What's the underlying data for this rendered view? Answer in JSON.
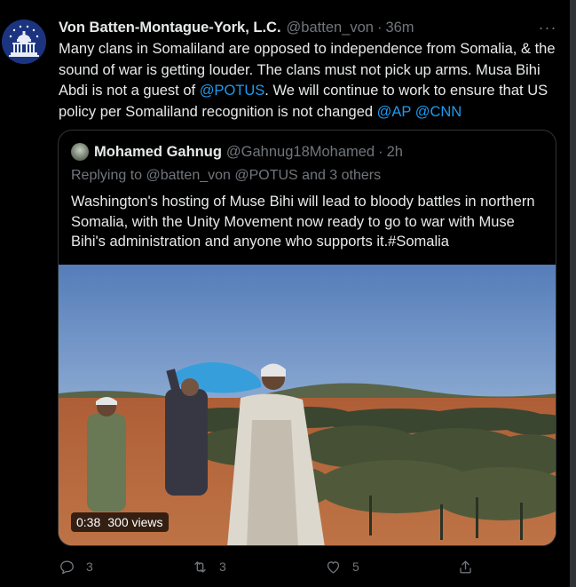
{
  "tweet": {
    "author_name": "Von Batten-Montague-York, L.C.",
    "author_handle": "@batten_von",
    "separator": "·",
    "time": "36m",
    "more_label": "···",
    "text_parts": [
      "Many clans in Somaliland are opposed to independence from Somalia, & the sound of war is getting louder. The clans must not pick up arms. Musa Bihi Abdi is not a guest of ",
      "@POTUS",
      ". We will continue to work to ensure that US policy per Somaliland recognition is not changed ",
      "@AP",
      " ",
      "@CNN"
    ]
  },
  "quote": {
    "author_name": "Mohamed Gahnug",
    "author_handle": "@Gahnug18Mohamed",
    "separator": "·",
    "time": "2h",
    "replying": "Replying to @batten_von @POTUS and 3 others",
    "text": "Washington's hosting of Muse Bihi will lead to bloody battles in northern Somalia, with the Unity Movement now ready to go to war with Muse Bihi's administration and anyone who supports it.#Somalia",
    "video": {
      "duration": "0:38",
      "views": "300 views"
    }
  },
  "actions": {
    "reply_count": "3",
    "retweet_count": "3",
    "like_count": "5",
    "share_count": ""
  },
  "colors": {
    "background": "#000000",
    "text": "#e7e9ea",
    "muted": "#71767b",
    "accent": "#1d9bf0",
    "border": "#2f3336"
  },
  "icons": {
    "reply": "reply-icon",
    "retweet": "retweet-icon",
    "like": "heart-icon",
    "share": "share-icon",
    "more": "more-icon"
  }
}
